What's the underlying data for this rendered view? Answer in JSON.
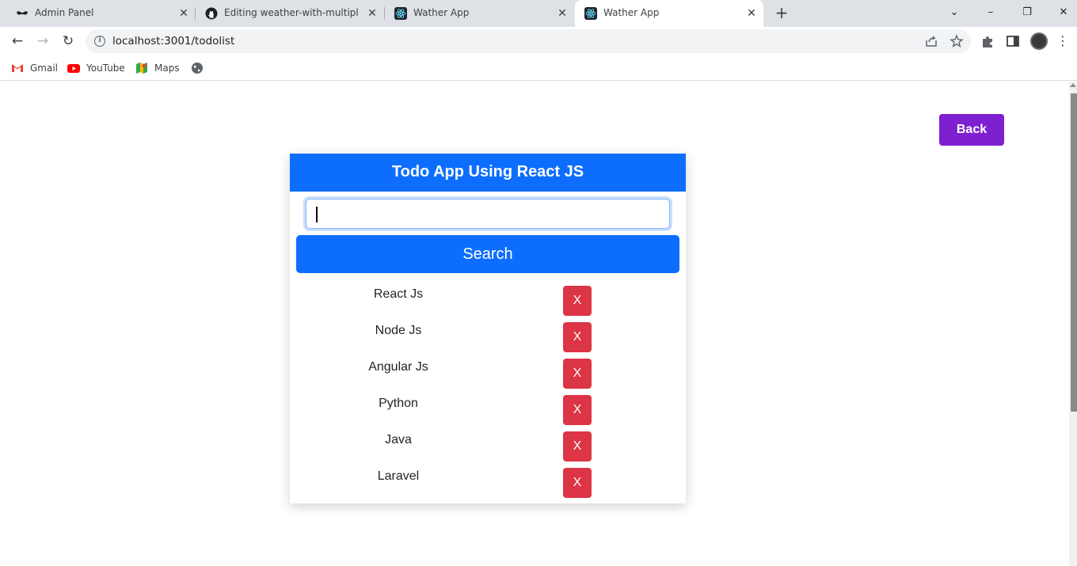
{
  "browser": {
    "tabs": [
      {
        "label": "Admin Panel",
        "icon": "mask-icon",
        "active": false
      },
      {
        "label": "Editing weather-with-multiple-pr",
        "icon": "github-icon",
        "active": false
      },
      {
        "label": "Wather App",
        "icon": "react-icon",
        "active": false
      },
      {
        "label": "Wather App",
        "icon": "react-icon",
        "active": true
      }
    ],
    "new_tab": "+",
    "window_controls": {
      "dropdown": "⌄",
      "minimize": "–",
      "restore": "❐",
      "close": "✕"
    },
    "nav": {
      "back": "←",
      "forward": "→",
      "reload": "↻"
    },
    "url": "localhost:3001/todolist",
    "bookmarks": [
      {
        "label": "Gmail",
        "icon": "gmail-icon"
      },
      {
        "label": "YouTube",
        "icon": "youtube-icon"
      },
      {
        "label": "Maps",
        "icon": "maps-icon"
      },
      {
        "label": "",
        "icon": "globe-icon"
      }
    ]
  },
  "page": {
    "back_label": "Back",
    "title": "Todo App Using React JS",
    "input_value": "",
    "search_label": "Search",
    "todos": [
      {
        "text": "React Js",
        "delete_label": "X"
      },
      {
        "text": "Node Js",
        "delete_label": "X"
      },
      {
        "text": "Angular Js",
        "delete_label": "X"
      },
      {
        "text": "Python",
        "delete_label": "X"
      },
      {
        "text": "Java",
        "delete_label": "X"
      },
      {
        "text": "Laravel",
        "delete_label": "X"
      }
    ]
  },
  "colors": {
    "primary": "#0d6efd",
    "danger": "#dc3545",
    "back_button": "#7e1fd0"
  }
}
